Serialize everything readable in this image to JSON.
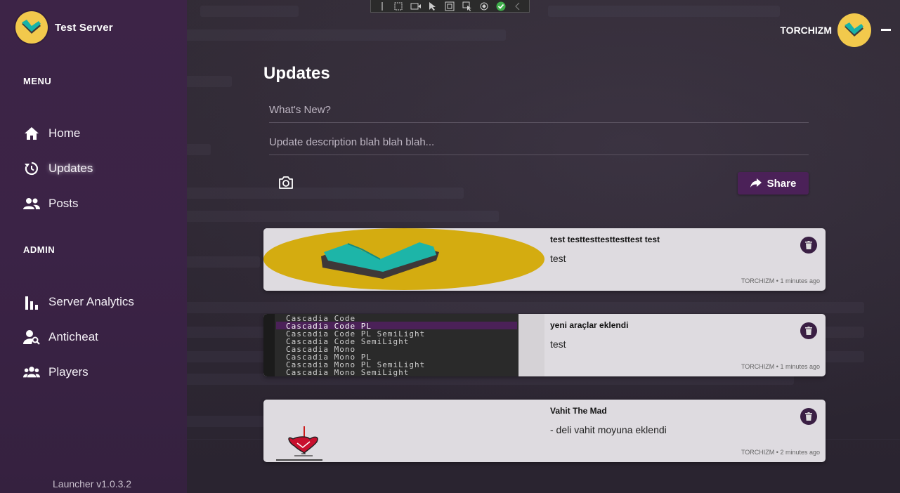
{
  "app": {
    "server_name": "Test Server",
    "version": "Launcher v1.0.3.2"
  },
  "user": {
    "name": "TORCHIZM"
  },
  "sidebar": {
    "menu_title": "MENU",
    "admin_title": "ADMIN",
    "menu_items": [
      {
        "label": "Home",
        "icon": "home-icon"
      },
      {
        "label": "Updates",
        "icon": "refresh-clock-icon",
        "active": true
      },
      {
        "label": "Posts",
        "icon": "people-icon"
      }
    ],
    "admin_items": [
      {
        "label": "Server Analytics",
        "icon": "bar-chart-icon"
      },
      {
        "label": "Anticheat",
        "icon": "user-search-icon"
      },
      {
        "label": "Players",
        "icon": "group-icon"
      }
    ]
  },
  "main": {
    "title": "Updates",
    "title_field": {
      "placeholder": "What's New?"
    },
    "description_field": {
      "placeholder": "Update description blah blah blah..."
    },
    "share_label": "Share"
  },
  "updates": [
    {
      "title": "test testtesttesttesttest test",
      "body": "test",
      "meta": "TORCHIZM • 1 minutes ago",
      "image": "logo-thumbnail"
    },
    {
      "title": "yeni araçlar eklendi",
      "body": "test",
      "meta": "TORCHIZM • 1 minutes ago",
      "image": "font-list-thumbnail",
      "code_lines": [
        "Cascadia Code",
        "Cascadia Code PL",
        "Cascadia Code PL SemiLight",
        "Cascadia Code SemiLight",
        "Cascadia Mono",
        "Cascadia Mono PL",
        "Cascadia Mono PL SemiLight",
        "Cascadia Mono SemiLight"
      ]
    },
    {
      "title": "Vahit The Mad",
      "body": "- deli vahit moyuna eklendi",
      "meta": "TORCHIZM • 2 minutes ago",
      "image": "heart-sketch-thumbnail"
    }
  ],
  "colors": {
    "sidebar": "#3d2447",
    "accent": "#4b2158",
    "logo_yellow": "#f2c94c",
    "logo_teal": "#17b3a8",
    "card_bg": "#dedbe0"
  }
}
